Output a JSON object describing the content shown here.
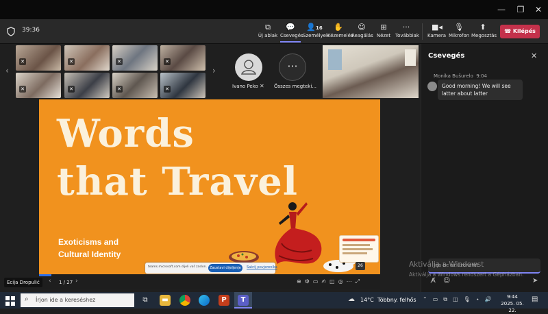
{
  "window": {
    "minimize_icon": "minimize-icon",
    "maximize_icon": "maximize-icon",
    "close_icon": "close-icon"
  },
  "meeting": {
    "duration": "39:36"
  },
  "toolbar": {
    "new_window": "Új ablak",
    "chat": "Csevegés",
    "people": "Személyek",
    "people_count": "16",
    "raise_hand": "Kézemelés",
    "react": "Reagálás",
    "view": "Nézet",
    "more": "Továbbiak",
    "camera": "Kamera",
    "mic": "Mikrofon",
    "share": "Megosztás",
    "leave": "Kilépés"
  },
  "participants": {
    "presenter_name": "Ivano Peko",
    "all_label": "Összes megteki...",
    "self_name": "Ecija Dropulić"
  },
  "slide": {
    "title_line1": "Words",
    "title_line2": "that Travel",
    "subtitle_line1": "Exoticisms and",
    "subtitle_line2": "Cultural Identity",
    "page_indicator": "1 / 27",
    "share_bar_text": "teams.microsoft.com dijeli vaš zaslon.",
    "stop_sharing": "Zaustavi dijeljenje",
    "hide": "Sakrij povjerenika",
    "corner_number": "26"
  },
  "chat": {
    "title": "Csevegés",
    "sender": "Monika Bušurelo",
    "time": "9:04",
    "message": "Good morning! We will see latter about latter",
    "input_placeholder": "Írja be az üzenetét",
    "watermark_title": "Aktiválja a Windowst",
    "watermark_sub": "Aktiválja a Windows rendszert a Gépházban."
  },
  "taskbar": {
    "search_placeholder": "Írjon ide a kereséshez",
    "weather": "14°C  Többny. felhős",
    "time": "9:44",
    "date": "2025. 05. 22."
  },
  "colors": {
    "slide_bg": "#f1921e",
    "leave_red": "#c4314b",
    "accent_purple": "#7f85f5",
    "taskbar": "#202a38"
  }
}
